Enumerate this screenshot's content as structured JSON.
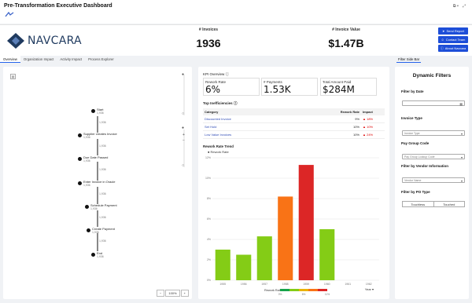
{
  "app": {
    "title": "Pre-Transformation Executive Dashboard",
    "topbar_icons": [
      "⧉ ▾",
      "⤢"
    ]
  },
  "header": {
    "brand": "NAVCARA",
    "invoices_label": "# Invoices",
    "invoices_value": "1936",
    "invoice_value_label": "# Invoice Value",
    "invoice_value": "$1.47B",
    "buttons": [
      "Send Report",
      "Contact Team",
      "About Navcara"
    ]
  },
  "tabs": [
    "Overview",
    "Organization Impact",
    "Activity Impact",
    "Process Explorer"
  ],
  "side_tab": "Filter Side Bar",
  "process_map": {
    "nodes": [
      {
        "label": "Start",
        "count": "1,936"
      },
      {
        "label": "Supplier creates Invoice",
        "count": "1,936"
      },
      {
        "label": "Due Date Passed",
        "count": "1,936"
      },
      {
        "label": "Enter Invoice in Oracle",
        "count": "1,936"
      },
      {
        "label": "Schedule Payment",
        "count": "1,936"
      },
      {
        "label": "Create Payment",
        "count": "1,936"
      },
      {
        "label": "End",
        "count": "1,936"
      }
    ],
    "edges": [
      "1,936",
      "1,936",
      "1,936",
      "1,936",
      "1,936",
      "1,936"
    ],
    "zoom": "100%"
  },
  "kpi": {
    "overview_label": "KPI Overview",
    "cards": [
      {
        "label": "Rework Rate",
        "value": "6%"
      },
      {
        "label": "# Payments",
        "value": "1.53K"
      },
      {
        "label": "Total Amount Paid",
        "value": "$284M"
      }
    ]
  },
  "inefficiencies": {
    "title": "Top Inefficiencies",
    "columns": [
      "Category",
      "Rework Rate",
      "Impact"
    ],
    "rows": [
      {
        "category": "Discounted Invoice",
        "rate": "9%",
        "impact": "18%"
      },
      {
        "category": "Set Hold",
        "rate": "10%",
        "impact": "10%"
      },
      {
        "category": "Low Value Invoices",
        "rate": "10%",
        "impact": "24%"
      }
    ]
  },
  "chart_data": {
    "type": "bar",
    "title": "Rework Rate Trend",
    "series_name": "Rework Rate",
    "categories": [
      "1955",
      "1956",
      "1957",
      "1958",
      "1959",
      "1960",
      "1961",
      "1962"
    ],
    "values": [
      3,
      2.5,
      4.3,
      8.2,
      11.3,
      5,
      0,
      0
    ],
    "colors": [
      "#dc2626",
      "#dc2626",
      "#84cc16",
      "#84cc16",
      "#f97316",
      "#dc2626",
      "#84cc16",
      "#84cc16"
    ],
    "bar_colors": [
      "#84cc16",
      "#84cc16",
      "#84cc16",
      "#f97316",
      "#dc2626",
      "#84cc16"
    ],
    "ylim": [
      0,
      12
    ],
    "yticks": [
      "0%",
      "2%",
      "4%",
      "6%",
      "8%",
      "10%",
      "12%"
    ],
    "xlabel": "Year",
    "legend_title": "Rework Rate",
    "legend_ticks": [
      "0%",
      "6%",
      "11%"
    ],
    "grid": true
  },
  "filters": {
    "title": "Dynamic Filters",
    "date_label": "Filter by Date",
    "invoice_type_label": "Invoice Type",
    "invoice_type_placeholder": "Invoice Type",
    "pay_group_label": "Pay Group Code",
    "pay_group_placeholder": "Pay Group Lookup Code",
    "vendor_label": "Filter by Vendor Information",
    "vendor_placeholder": "Vendor Name",
    "po_label": "Filter by PO Type",
    "po_options": [
      "Touchless",
      "Touched"
    ]
  }
}
